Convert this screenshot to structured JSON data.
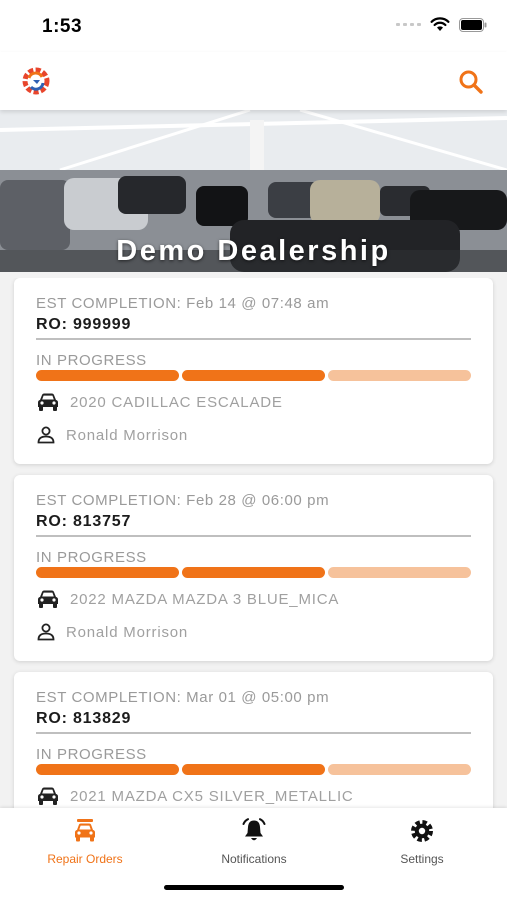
{
  "status_bar": {
    "time": "1:53"
  },
  "header": {
    "logo_icon": "gear-logo-icon",
    "search_icon": "search-icon"
  },
  "hero": {
    "title": "Demo Dealership"
  },
  "repair_orders": [
    {
      "est_completion": "EST COMPLETION: Feb 14  @ 07:48 am",
      "ro": "RO: 999999",
      "status": "IN PROGRESS",
      "progress_steps_done": 2,
      "progress_steps_total": 3,
      "vehicle": "2020 CADILLAC ESCALADE",
      "advisor": "Ronald Morrison"
    },
    {
      "est_completion": "EST COMPLETION: Feb 28  @ 06:00 pm",
      "ro": "RO: 813757",
      "status": "IN PROGRESS",
      "progress_steps_done": 2,
      "progress_steps_total": 3,
      "vehicle": "2022 MAZDA MAZDA 3 BLUE_MICA",
      "advisor": "Ronald Morrison"
    },
    {
      "est_completion": "EST COMPLETION: Mar 01  @ 05:00 pm",
      "ro": "RO: 813829",
      "status": "IN PROGRESS",
      "progress_steps_done": 2,
      "progress_steps_total": 3,
      "vehicle": "2021 MAZDA CX5 SILVER_METALLIC",
      "advisor": ""
    }
  ],
  "tabs": [
    {
      "label": "Repair Orders",
      "icon": "car-service-icon",
      "active": true
    },
    {
      "label": "Notifications",
      "icon": "bell-icon",
      "active": false
    },
    {
      "label": "Settings",
      "icon": "gear-icon",
      "active": false
    }
  ],
  "colors": {
    "accent": "#f07318",
    "accent_light": "#f6c29b",
    "text_muted": "#9a9a9a"
  }
}
